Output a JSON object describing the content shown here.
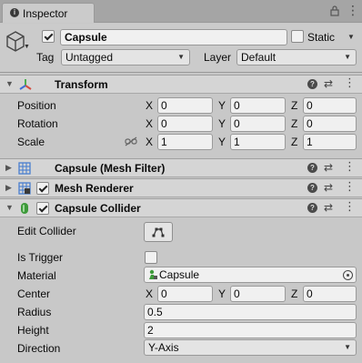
{
  "window": {
    "tab_label": "Inspector"
  },
  "gameobject": {
    "active": true,
    "name": "Capsule",
    "static_label": "Static",
    "static_checked": false,
    "tag_label": "Tag",
    "tag_value": "Untagged",
    "layer_label": "Layer",
    "layer_value": "Default"
  },
  "transform": {
    "title": "Transform",
    "position": {
      "label": "Position",
      "x": "0",
      "y": "0",
      "z": "0"
    },
    "rotation": {
      "label": "Rotation",
      "x": "0",
      "y": "0",
      "z": "0"
    },
    "scale": {
      "label": "Scale",
      "x": "1",
      "y": "1",
      "z": "1"
    }
  },
  "mesh_filter": {
    "title": "Capsule (Mesh Filter)"
  },
  "mesh_renderer": {
    "title": "Mesh Renderer",
    "enabled": true
  },
  "capsule_collider": {
    "title": "Capsule Collider",
    "enabled": true,
    "edit_collider_label": "Edit Collider",
    "is_trigger_label": "Is Trigger",
    "is_trigger": false,
    "material_label": "Material",
    "material_value": "Capsule",
    "center": {
      "label": "Center",
      "x": "0",
      "y": "0",
      "z": "0"
    },
    "radius_label": "Radius",
    "radius_value": "0.5",
    "height_label": "Height",
    "height_value": "2",
    "direction_label": "Direction",
    "direction_value": "Y-Axis"
  },
  "axis_labels": {
    "x": "X",
    "y": "Y",
    "z": "Z"
  },
  "colors": {
    "background": "#c8c8c8",
    "header": "#d5d5d5",
    "field": "#f0f0f0",
    "transform_red": "#d64b3f",
    "transform_green": "#4caf50",
    "transform_blue": "#3f6fd6",
    "mesh_icon_blue": "#4a7fcf",
    "collider_green": "#3d9a3a"
  }
}
